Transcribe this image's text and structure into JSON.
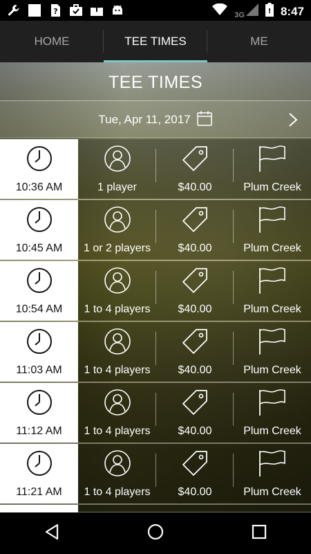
{
  "status_bar": {
    "time": "8:47",
    "network": "3G",
    "icons": [
      "wrench-icon",
      "square-notification-icon",
      "question-sim-icon",
      "briefcase-check-icon",
      "upload-box-icon",
      "android-icon",
      "wifi-icon",
      "signal-icon",
      "battery-icon"
    ]
  },
  "tabs": [
    {
      "label": "HOME",
      "active": false
    },
    {
      "label": "TEE TIMES",
      "active": true
    },
    {
      "label": "ME",
      "active": false
    }
  ],
  "page": {
    "title": "TEE TIMES",
    "date": "Tue, Apr 11, 2017"
  },
  "tee_times": [
    {
      "time": "10:36 AM",
      "players": "1 player",
      "price": "$40.00",
      "course": "Plum Creek"
    },
    {
      "time": "10:45 AM",
      "players": "1 or 2 players",
      "price": "$40.00",
      "course": "Plum Creek"
    },
    {
      "time": "10:54 AM",
      "players": "1 to 4 players",
      "price": "$40.00",
      "course": "Plum Creek"
    },
    {
      "time": "11:03 AM",
      "players": "1 to 4 players",
      "price": "$40.00",
      "course": "Plum Creek"
    },
    {
      "time": "11:12 AM",
      "players": "1 to 4 players",
      "price": "$40.00",
      "course": "Plum Creek"
    },
    {
      "time": "11:21 AM",
      "players": "1 to 4 players",
      "price": "$40.00",
      "course": "Plum Creek"
    }
  ],
  "colors": {
    "accent": "#7fc8c6",
    "tab_bar": "#202020",
    "time_cell": "#ffffff"
  }
}
